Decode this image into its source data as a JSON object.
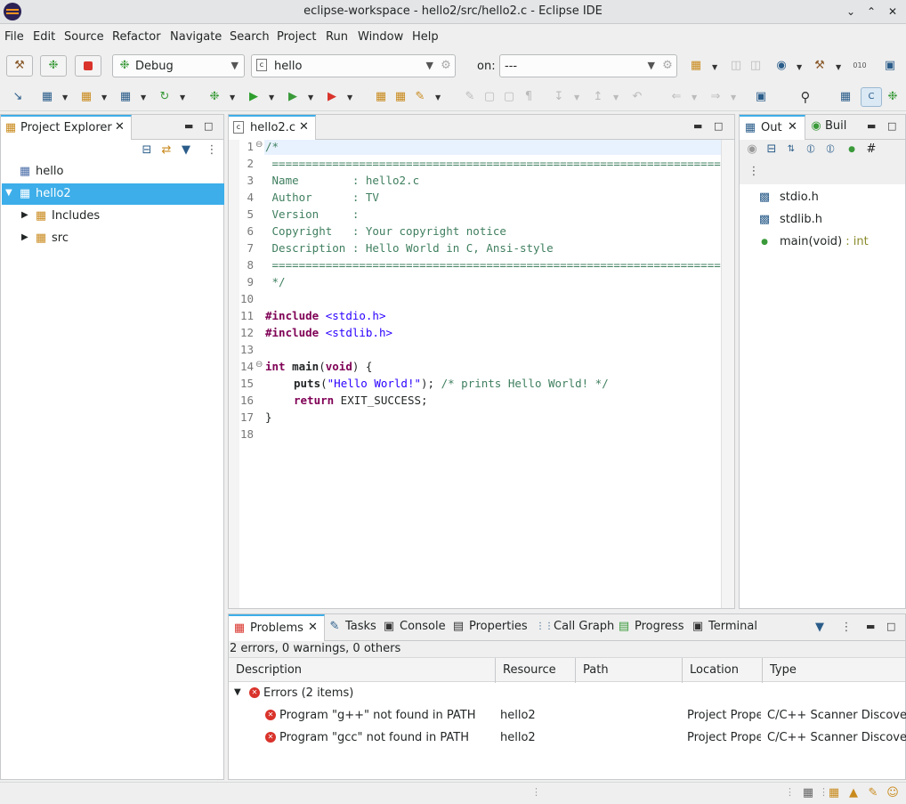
{
  "window": {
    "title": "eclipse-workspace - hello2/src/hello2.c - Eclipse IDE"
  },
  "menu": [
    "File",
    "Edit",
    "Source",
    "Refactor",
    "Navigate",
    "Search",
    "Project",
    "Run",
    "Window",
    "Help"
  ],
  "toolbar": {
    "mode": "Debug",
    "config": "hello",
    "on_label": "on:",
    "target": "---"
  },
  "project_explorer": {
    "tab_label": "Project Explorer",
    "items": [
      {
        "label": "hello"
      },
      {
        "label": "hello2"
      },
      {
        "label": "Includes"
      },
      {
        "label": "src"
      }
    ]
  },
  "editor": {
    "tab_label": "hello2.c",
    "line_numbers": [
      "1",
      "2",
      "3",
      "4",
      "5",
      "6",
      "7",
      "8",
      "9",
      "10",
      "11",
      "12",
      "13",
      "14",
      "15",
      "16",
      "17",
      "18"
    ],
    "lines": {
      "l1": "/*",
      "l2": " ============================================================================",
      "l3": " Name        : hello2.c",
      "l4": " Author      : TV",
      "l5": " Version     :",
      "l6": " Copyright   : Your copyright notice",
      "l7": " Description : Hello World in C, Ansi-style",
      "l8": " ============================================================================",
      "l9": " */",
      "l11_kw": "#include",
      "l11_inc": "<stdio.h>",
      "l12_kw": "#include",
      "l12_inc": "<stdlib.h>",
      "l14_kw1": "int",
      "l14_fn": "main",
      "l14_p1": "(",
      "l14_kw2": "void",
      "l14_p2": ") {",
      "l15_fn": "puts",
      "l15_p1": "(",
      "l15_str": "\"Hello World!\"",
      "l15_p2": ");",
      "l15_cm": "/* prints Hello World! */",
      "l16_kw": "return",
      "l16_rest": " EXIT_SUCCESS;",
      "l17": "}"
    }
  },
  "outline": {
    "tab_label": "Out",
    "tab2_label": "Buil",
    "items": [
      {
        "label": "stdio.h"
      },
      {
        "label": "stdlib.h"
      },
      {
        "label": "main(void)",
        "type": ": int"
      }
    ]
  },
  "problems": {
    "tabs": [
      "Problems",
      "Tasks",
      "Console",
      "Properties",
      "Call Graph",
      "Progress",
      "Terminal"
    ],
    "summary": "2 errors, 0 warnings, 0 others",
    "columns": [
      "Description",
      "Resource",
      "Path",
      "Location",
      "Type"
    ],
    "group": "Errors (2 items)",
    "rows": [
      {
        "description": "Program \"g++\" not found in PATH",
        "resource": "hello2",
        "path": "",
        "location": "Project Prope",
        "type": "C/C++ Scanner Discovery"
      },
      {
        "description": "Program \"gcc\" not found in PATH",
        "resource": "hello2",
        "path": "",
        "location": "Project Prope",
        "type": "C/C++ Scanner Discovery"
      }
    ]
  },
  "colors": {
    "selection": "#3daee9",
    "keyword": "#7f0055",
    "comment": "#3f7f5f",
    "string": "#2a00ff"
  }
}
